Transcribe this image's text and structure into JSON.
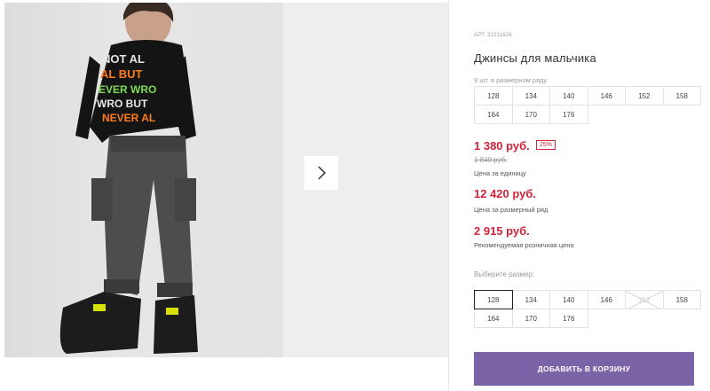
{
  "product": {
    "article": "АРТ. 32211626",
    "title": "Джинсы для мальчика",
    "row_info": "9 шт. в размерном ряду",
    "row_sizes": [
      "128",
      "134",
      "140",
      "146",
      "152",
      "158",
      "164",
      "170",
      "176"
    ]
  },
  "pricing": {
    "price": "1 380 руб.",
    "discount": "25%",
    "old_price": "1 840 руб.",
    "unit_label": "Цена за единицу",
    "row_price": "12 420 руб.",
    "row_label": "Цена за размерный ряд",
    "rrp_price": "2 915 руб.",
    "rrp_label": "Рекомендуемая розничная цена"
  },
  "size_picker": {
    "label": "Выберите размер:",
    "selected": "128",
    "disabled": [
      "152"
    ],
    "sizes": [
      "128",
      "134",
      "140",
      "146",
      "152",
      "158",
      "164",
      "170",
      "176"
    ]
  },
  "cart": {
    "add_label": "ДОБАВИТЬ В КОРЗИНУ"
  },
  "colors": {
    "accent": "#7b63a8",
    "price": "#d0243b"
  },
  "gallery": {
    "next_icon": "chevron-right-icon"
  }
}
